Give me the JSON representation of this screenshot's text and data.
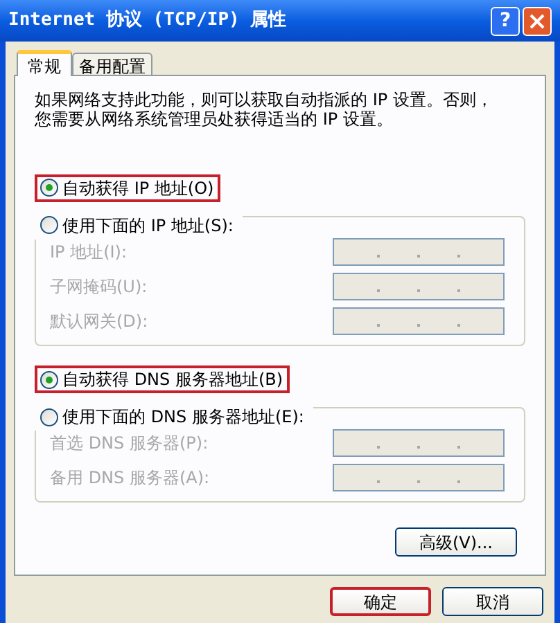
{
  "window": {
    "title": "Internet 协议 (TCP/IP) 属性",
    "help_label": "?"
  },
  "tabs": [
    {
      "label": "常规",
      "selected": true
    },
    {
      "label": "备用配置",
      "selected": false
    }
  ],
  "description_lines": [
    "如果网络支持此功能，则可以获取自动指派的 IP 设置。否则，",
    "您需要从网络系统管理员处获得适当的 IP 设置。"
  ],
  "ip_section": {
    "auto_option": {
      "label": "自动获得 IP 地址(O)",
      "selected": true,
      "highlighted": true
    },
    "manual_option": {
      "label": "使用下面的 IP 地址(S):",
      "selected": false,
      "highlighted": false
    },
    "fields": [
      {
        "label": "IP 地址(I):",
        "disabled": true
      },
      {
        "label": "子网掩码(U):",
        "disabled": true
      },
      {
        "label": "默认网关(D):",
        "disabled": true
      }
    ]
  },
  "dns_section": {
    "auto_option": {
      "label": "自动获得 DNS 服务器地址(B)",
      "selected": true,
      "highlighted": true
    },
    "manual_option": {
      "label": "使用下面的 DNS 服务器地址(E):",
      "selected": false,
      "highlighted": false
    },
    "fields": [
      {
        "label": "首选 DNS 服务器(P):",
        "disabled": true
      },
      {
        "label": "备用 DNS 服务器(A):",
        "disabled": true
      }
    ]
  },
  "advanced_button": {
    "label": "高级(V)..."
  },
  "footer_buttons": [
    {
      "label": "确定",
      "highlighted": true
    },
    {
      "label": "取消",
      "highlighted": false
    }
  ]
}
